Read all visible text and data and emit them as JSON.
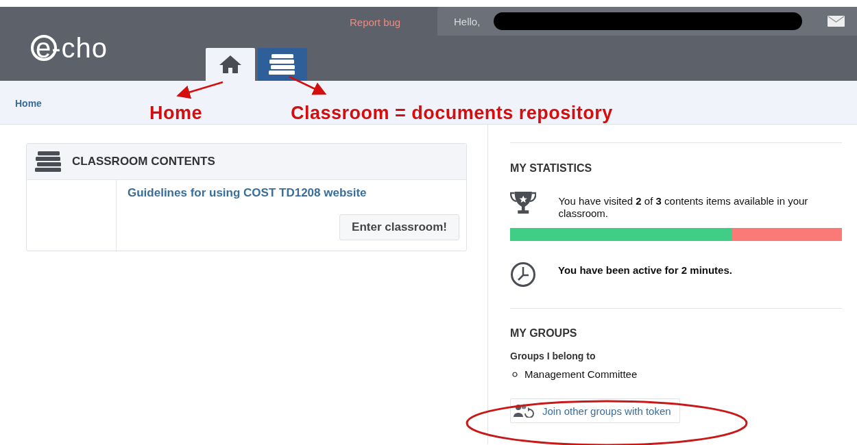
{
  "header": {
    "logo": "e-cho",
    "report_bug": "Report bug",
    "greeting": "Hello,"
  },
  "tabs": [
    {
      "kind": "home",
      "selected": true
    },
    {
      "kind": "classroom",
      "selected": false
    }
  ],
  "breadcrumb": [
    "Home"
  ],
  "annotations": [
    "Home",
    "Classroom = documents repository"
  ],
  "classroom_card": {
    "title": "CLASSROOM CONTENTS",
    "items": [
      {
        "title": "Guidelines for using COST TD1208 website",
        "button": "Enter classroom!"
      }
    ]
  },
  "statistics": {
    "title": "MY STATISTICS",
    "visited_text": "You have visited **2** of **3** contents items available in your classroom.",
    "level": 0.67,
    "active_text": "You have been active for 2 minutes."
  },
  "groups": {
    "title": "MY GROUPS",
    "subtitle": "Groups I belong to",
    "items": [
      "Management Committee"
    ],
    "join_button": "Join other groups with token"
  }
}
